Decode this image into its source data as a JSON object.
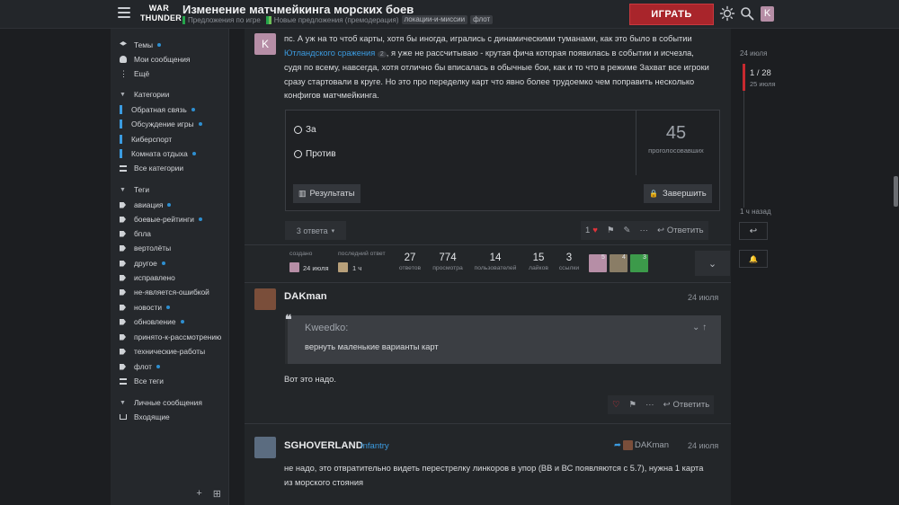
{
  "header": {
    "logo_line1": "WAR",
    "logo_line2": "THUNDER",
    "title": "Изменение матчмейкинга морских боев",
    "crumb1": "Предложения по игре",
    "crumb2": "Новые предложения (премодерация)",
    "tag1": "локации-и-миссии",
    "tag2": "флот",
    "play_label": "ИГРАТЬ",
    "user_initial": "K"
  },
  "sidebar": {
    "top": [
      "Темы",
      "Мои сообщения",
      "Ещё"
    ],
    "categories_title": "Категории",
    "categories": [
      {
        "label": "Обратная связь",
        "color": "#3b9be0"
      },
      {
        "label": "Обсуждение игры",
        "color": "#3b9be0"
      },
      {
        "label": "Киберспорт",
        "color": "#3b9be0"
      },
      {
        "label": "Комната отдыха",
        "color": "#3b9be0"
      },
      {
        "label": "Все категории",
        "color": ""
      }
    ],
    "tags_title": "Теги",
    "tags": [
      "авиация",
      "боевые-рейтинги",
      "бпла",
      "вертолёты",
      "другое",
      "исправлено",
      "не-является-ошибкой",
      "новости",
      "обновление",
      "принято-к-рассмотрению",
      "технические-работы",
      "флот",
      "Все теги"
    ],
    "messages_title": "Личные сообщения",
    "inbox": "Входящие"
  },
  "post1": {
    "avatar_initial": "K",
    "line1": "пс. А уж на то чтоб карты, хотя бы иногда, игрались с динамическими туманами, как это было в событии",
    "link": "Ютландского сражения",
    "link_count": "2",
    "line2": ", я уже не рассчитываю - крутая фича которая появилась в событии и исчезла,",
    "line3": "судя по всему, навсегда, хотя отлично бы вписалась в обычные бои, как и то что в режиме Захват все игроки",
    "line4": "сразу стартовали в круге. Но это про переделку карт что явно более трудоемко чем поправить несколько",
    "line5": "конфигов матчмейкинга.",
    "poll": {
      "option1": "За",
      "option2": "Против",
      "count": "45",
      "voters_label": "проголосовавших",
      "results_label": "Результаты",
      "close_label": "Завершить"
    },
    "replies_label": "3 ответа",
    "likes": "1",
    "reply_label": "Ответить",
    "created_label": "создано",
    "created_date": "24 июля",
    "last_reply_label": "последний ответ",
    "last_reply_date": "1 ч",
    "stats": [
      {
        "n": "27",
        "l": "ответов"
      },
      {
        "n": "774",
        "l": "просмотра"
      },
      {
        "n": "14",
        "l": "пользователей"
      },
      {
        "n": "15",
        "l": "лайков"
      },
      {
        "n": "3",
        "l": "ссылки"
      }
    ],
    "avatar_counts": [
      "5",
      "4",
      "3"
    ]
  },
  "post2": {
    "username": "DAKman",
    "date": "24 июля",
    "quote_author": "Kweedko:",
    "quote_text": "вернуть маленькие варианты карт",
    "text": "Вот это надо.",
    "reply_label": "Ответить"
  },
  "post3": {
    "username": "SGHOVERLAND",
    "flair": "Infantry",
    "reply_to": "DAKman",
    "date": "24 июля",
    "line1": "не надо, это отвратительно видеть перестрелку линкоров в упор (ВВ и ВС появляются с 5.7), нужна 1 карта",
    "line2": "из морского стояния"
  },
  "timeline": {
    "top_date": "24 июля",
    "position": "1 / 28",
    "position_date": "25 июля",
    "bottom_date": "1 ч назад"
  },
  "colors": {
    "accent": "#3b9be0",
    "play": "#a9252b",
    "heart": "#e0333a"
  }
}
